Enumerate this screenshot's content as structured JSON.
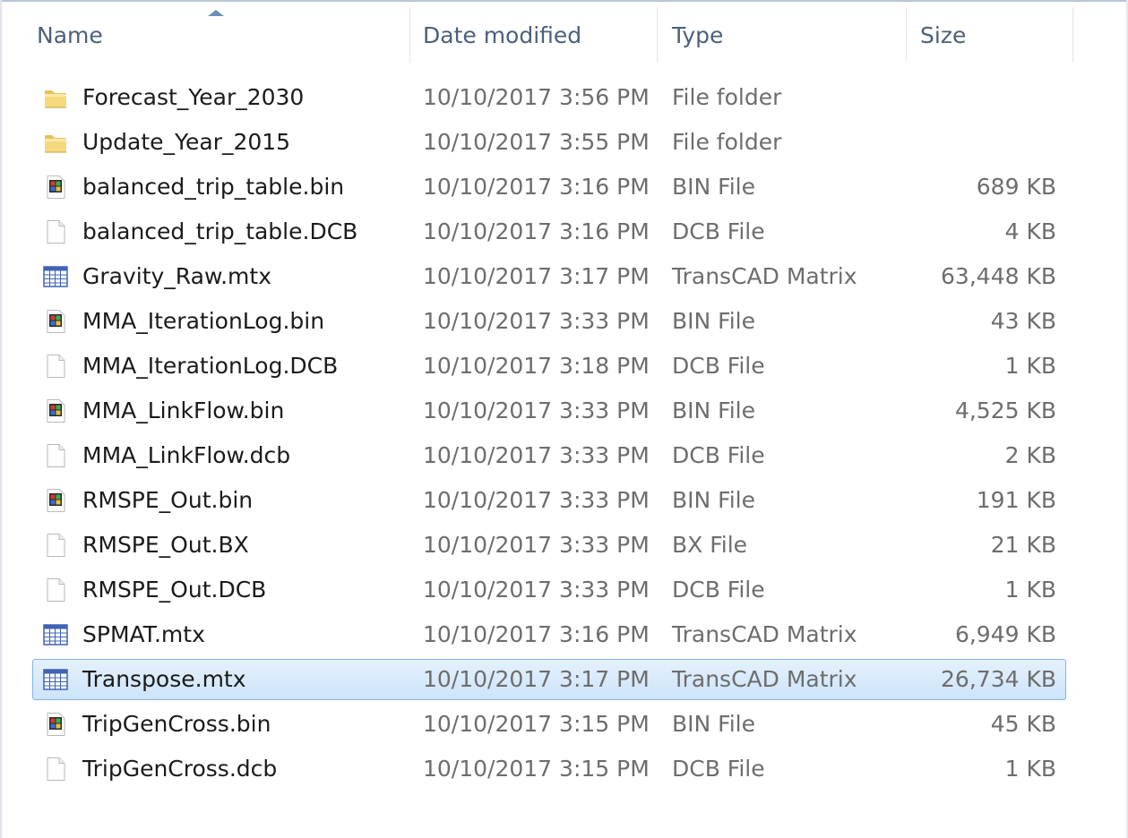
{
  "columns": {
    "name": "Name",
    "date": "Date modified",
    "type": "Type",
    "size": "Size"
  },
  "files": [
    {
      "name": "Forecast_Year_2030",
      "date": "10/10/2017 3:56 PM",
      "type": "File folder",
      "size": "",
      "icon": "folder-icon"
    },
    {
      "name": "Update_Year_2015",
      "date": "10/10/2017 3:55 PM",
      "type": "File folder",
      "size": "",
      "icon": "folder-icon"
    },
    {
      "name": "balanced_trip_table.bin",
      "date": "10/10/2017 3:16 PM",
      "type": "BIN File",
      "size": "689 KB",
      "icon": "bin-file-icon"
    },
    {
      "name": "balanced_trip_table.DCB",
      "date": "10/10/2017 3:16 PM",
      "type": "DCB File",
      "size": "4 KB",
      "icon": "blank-file-icon"
    },
    {
      "name": "Gravity_Raw.mtx",
      "date": "10/10/2017 3:17 PM",
      "type": "TransCAD Matrix",
      "size": "63,448 KB",
      "icon": "matrix-file-icon"
    },
    {
      "name": "MMA_IterationLog.bin",
      "date": "10/10/2017 3:33 PM",
      "type": "BIN File",
      "size": "43 KB",
      "icon": "bin-file-icon"
    },
    {
      "name": "MMA_IterationLog.DCB",
      "date": "10/10/2017 3:18 PM",
      "type": "DCB File",
      "size": "1 KB",
      "icon": "blank-file-icon"
    },
    {
      "name": "MMA_LinkFlow.bin",
      "date": "10/10/2017 3:33 PM",
      "type": "BIN File",
      "size": "4,525 KB",
      "icon": "bin-file-icon"
    },
    {
      "name": "MMA_LinkFlow.dcb",
      "date": "10/10/2017 3:33 PM",
      "type": "DCB File",
      "size": "2 KB",
      "icon": "blank-file-icon"
    },
    {
      "name": "RMSPE_Out.bin",
      "date": "10/10/2017 3:33 PM",
      "type": "BIN File",
      "size": "191 KB",
      "icon": "bin-file-icon"
    },
    {
      "name": "RMSPE_Out.BX",
      "date": "10/10/2017 3:33 PM",
      "type": "BX File",
      "size": "21 KB",
      "icon": "blank-file-icon"
    },
    {
      "name": "RMSPE_Out.DCB",
      "date": "10/10/2017 3:33 PM",
      "type": "DCB File",
      "size": "1 KB",
      "icon": "blank-file-icon"
    },
    {
      "name": "SPMAT.mtx",
      "date": "10/10/2017 3:16 PM",
      "type": "TransCAD Matrix",
      "size": "6,949 KB",
      "icon": "matrix-file-icon"
    },
    {
      "name": "Transpose.mtx",
      "date": "10/10/2017 3:17 PM",
      "type": "TransCAD Matrix",
      "size": "26,734 KB",
      "icon": "matrix-file-icon",
      "selected": true
    },
    {
      "name": "TripGenCross.bin",
      "date": "10/10/2017 3:15 PM",
      "type": "BIN File",
      "size": "45 KB",
      "icon": "bin-file-icon"
    },
    {
      "name": "TripGenCross.dcb",
      "date": "10/10/2017 3:15 PM",
      "type": "DCB File",
      "size": "1 KB",
      "icon": "blank-file-icon"
    }
  ],
  "colors": {
    "selection_bg": "#cce4f9",
    "selection_border": "#83b4e3",
    "header_text": "#4c607a",
    "meta_text": "#6d6d6d"
  }
}
